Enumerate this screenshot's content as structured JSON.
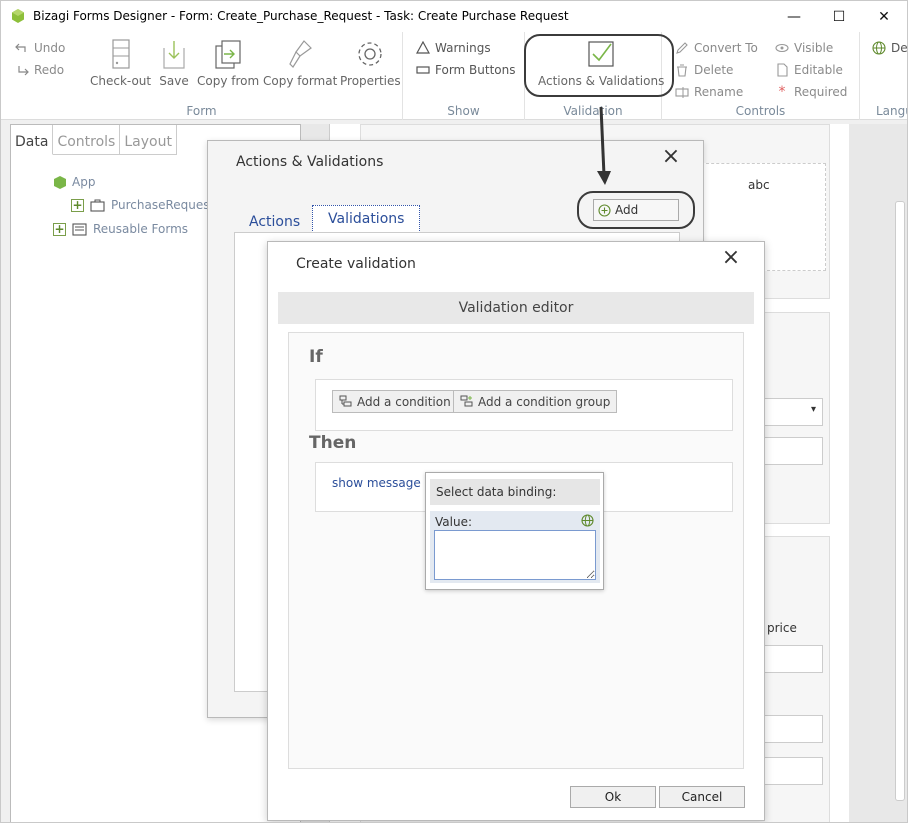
{
  "window": {
    "title": "Bizagi Forms Designer  - Form: Create_Purchase_Request - Task:  Create Purchase Request",
    "controls": {
      "minimize": "—",
      "maximize": "☐",
      "close": "✕"
    }
  },
  "ribbon": {
    "undo": "Undo",
    "redo": "Redo",
    "checkout": "Check-out",
    "save": "Save",
    "copy_from": "Copy from",
    "copy_format": "Copy format",
    "properties": "Properties",
    "form_group": "Form",
    "warnings": "Warnings",
    "form_buttons": "Form Buttons",
    "show_group": "Show",
    "actions_validations": "Actions & Validations",
    "validation_group": "Validation",
    "convert_to": "Convert To",
    "delete": "Delete",
    "rename": "Rename",
    "controls_group": "Controls",
    "visible": "Visible",
    "editable": "Editable",
    "required": "Required",
    "det": "Det",
    "langu_group": "Langu"
  },
  "left_panel": {
    "tabs": [
      "Data",
      "Controls",
      "Layout"
    ],
    "tree": {
      "app": "App",
      "purchase_request": "PurchaseRequest",
      "reusable_forms": "Reusable Forms"
    }
  },
  "canvas": {
    "abc": "abc",
    "price": "price"
  },
  "av_dialog": {
    "title": "Actions & Validations",
    "tab_actions": "Actions",
    "tab_validations": "Validations",
    "add": "Add"
  },
  "cv_dialog": {
    "title": "Create validation",
    "editor_header": "Validation editor",
    "if_label": "If",
    "add_condition": "Add a condition",
    "add_condition_group": "Add a condition group",
    "then_label": "Then",
    "show_message": "show message",
    "ok": "Ok",
    "cancel": "Cancel"
  },
  "binding_popup": {
    "header": "Select data binding:",
    "value_label": "Value:",
    "value": ""
  },
  "colors": {
    "accent_green": "#7ab648",
    "link_blue": "#2b4e9a",
    "ribbon_label": "#7a8a9a"
  }
}
